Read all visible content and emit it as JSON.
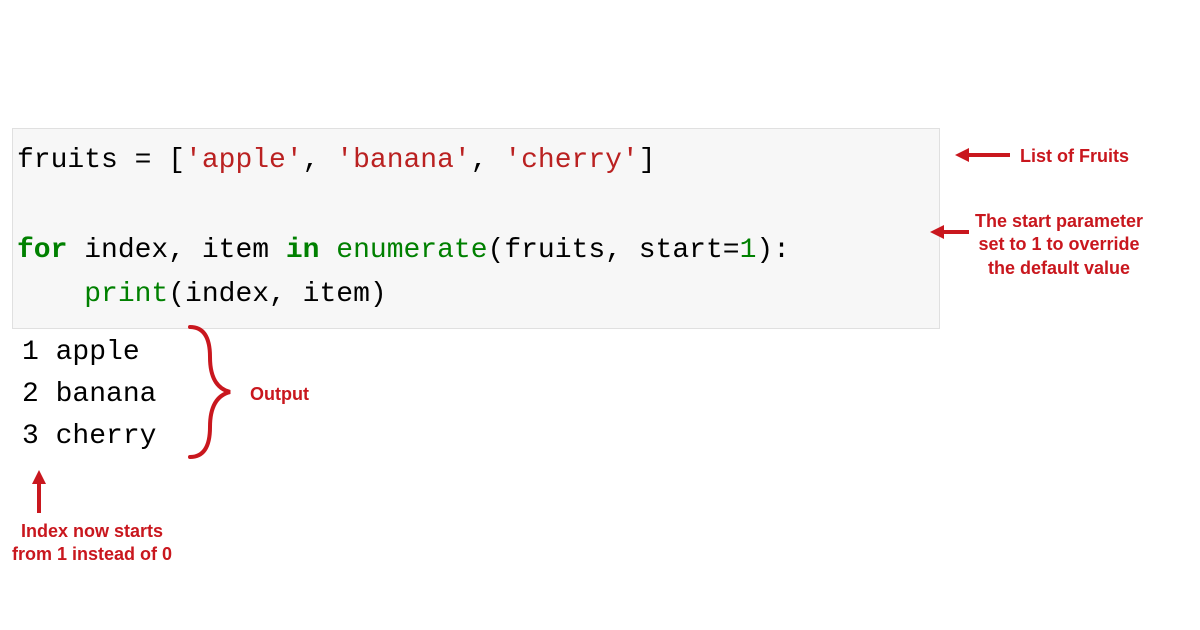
{
  "code": {
    "var_name": "fruits",
    "assign": " = [",
    "str1": "'apple'",
    "comma1": ", ",
    "str2": "'banana'",
    "comma2": ", ",
    "str3": "'cherry'",
    "close_bracket": "]",
    "blank_line": "",
    "kw_for": "for",
    "loop_vars": " index, item ",
    "kw_in": "in",
    "space1": " ",
    "fn_enumerate": "enumerate",
    "paren_open": "(fruits, start=",
    "num1": "1",
    "paren_close": "):",
    "indent": "    ",
    "fn_print": "print",
    "print_args": "(index, item)"
  },
  "output": {
    "line1": "1 apple",
    "line2": "2 banana",
    "line3": "3 cherry"
  },
  "annotations": {
    "fruits_label": "List of Fruits",
    "start_label_line1": "The start parameter",
    "start_label_line2": "set to 1 to override",
    "start_label_line3": "the default value",
    "output_label": "Output",
    "index_label_line1": "Index now starts",
    "index_label_line2": "from 1 instead of 0"
  }
}
